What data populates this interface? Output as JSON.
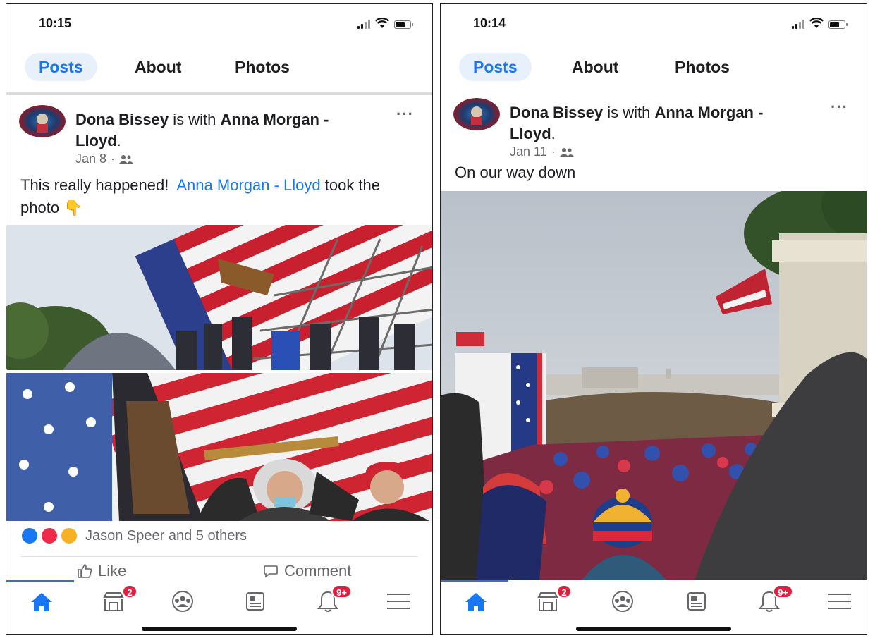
{
  "left": {
    "status": {
      "time": "10:15"
    },
    "tabs": [
      "Posts",
      "About",
      "Photos"
    ],
    "post": {
      "author": "Dona Bissey",
      "with_text": "is with",
      "tagged": "Anna Morgan - Lloyd",
      "period": ".",
      "date": "Jan 8",
      "dot": "·",
      "text_before": "This really happened!",
      "text_link": "Anna Morgan - Lloyd",
      "text_after": "took the photo",
      "emoji": "👇",
      "reactions": "Jason Speer and 5 others",
      "like_label": "Like",
      "comment_label": "Comment"
    },
    "nav": {
      "marketplace_badge": "2",
      "notifications_badge": "9+"
    }
  },
  "right": {
    "status": {
      "time": "10:14"
    },
    "tabs": [
      "Posts",
      "About",
      "Photos"
    ],
    "post": {
      "author": "Dona Bissey",
      "with_text": "is with",
      "tagged": "Anna Morgan - Lloyd",
      "period": ".",
      "date": "Jan 11",
      "dot": "·",
      "text": "On our way down"
    },
    "nav": {
      "marketplace_badge": "2",
      "notifications_badge": "9+"
    }
  },
  "colors": {
    "accent": "#1877f2",
    "badge": "#e41e3f",
    "meta": "#65676b"
  },
  "icons": [
    "home-icon",
    "marketplace-icon",
    "groups-icon",
    "news-icon",
    "bell-icon",
    "menu-icon",
    "friends-icon",
    "more-icon",
    "thumb-up-icon",
    "comment-icon"
  ]
}
